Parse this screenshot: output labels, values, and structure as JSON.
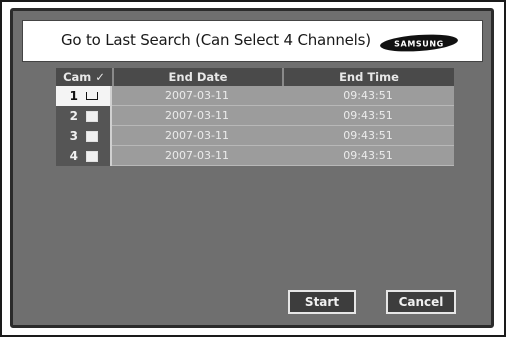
{
  "dialog": {
    "title": "Go to Last Search (Can Select 4 Channels)",
    "logo_text": "SAMSUNG"
  },
  "table": {
    "headers": {
      "cam": "Cam ✓",
      "end_date": "End Date",
      "end_time": "End Time"
    },
    "rows": [
      {
        "cam": "1",
        "end_date": "2007-03-11",
        "end_time": "09:43:51",
        "checked": true
      },
      {
        "cam": "2",
        "end_date": "2007-03-11",
        "end_time": "09:43:51",
        "checked": false
      },
      {
        "cam": "3",
        "end_date": "2007-03-11",
        "end_time": "09:43:51",
        "checked": false
      },
      {
        "cam": "4",
        "end_date": "2007-03-11",
        "end_time": "09:43:51",
        "checked": false
      }
    ]
  },
  "buttons": {
    "start": "Start",
    "cancel": "Cancel"
  },
  "colors": {
    "panel": "#6f6f6f",
    "header": "#4a4a4a",
    "row": "#9c9c9c",
    "button": "#3d3d3d"
  }
}
